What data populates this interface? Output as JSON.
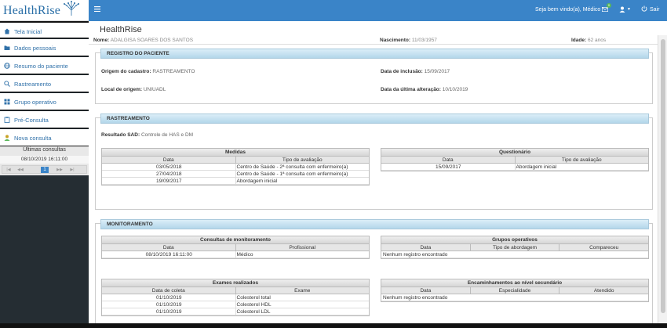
{
  "brand": {
    "name": "HealthRise"
  },
  "topbar": {
    "welcome": "Seja bem vindo(a), Médico",
    "mail_badge": "0",
    "user_caret": "▼",
    "logout": "Sair"
  },
  "sidebar": {
    "items": [
      {
        "label": "Tela Inicial",
        "icon": "home-icon"
      },
      {
        "label": "Dados pessoais",
        "icon": "folder-icon"
      },
      {
        "label": "Resumo do paciente",
        "icon": "globe-icon"
      },
      {
        "label": "Rastreamento",
        "icon": "search-icon"
      },
      {
        "label": "Grupo operativo",
        "icon": "grid-icon"
      },
      {
        "label": "Pré-Consulta",
        "icon": "clipboard-icon"
      },
      {
        "label": "Nova consulta",
        "icon": "user-icon"
      }
    ],
    "last_consults": {
      "title": "Últimas consultas",
      "rows": [
        "08/10/2019 16:11:00"
      ],
      "pager": {
        "first": "|◀",
        "prev": "◀◀",
        "current": "1",
        "next": "▶▶",
        "last": "▶|"
      }
    }
  },
  "main": {
    "title": "HealthRise",
    "patient": {
      "name_label": "Nome:",
      "name_value": "ADALGISA SOARES DOS SANTOS",
      "birth_label": "Nascimento:",
      "birth_value": "11/03/1957",
      "age_label": "Idade:",
      "age_value": "62 anos"
    },
    "registro": {
      "heading": "REGISTRO DO PACIENTE",
      "origem_label": "Origem do cadastro:",
      "origem_value": "RASTREAMENTO",
      "inclusao_label": "Data de inclusão:",
      "inclusao_value": "15/09/2017",
      "local_label": "Local de origem:",
      "local_value": "UNIUADL",
      "alteracao_label": "Data da última alteração:",
      "alteracao_value": "10/10/2019"
    },
    "rastreamento": {
      "heading": "RASTREAMENTO",
      "sad_label": "Resultado SAD:",
      "sad_value": "Controle de HAS e DM",
      "medidas": {
        "title": "Medidas",
        "columns": [
          "Data",
          "Tipo de avaliação"
        ],
        "rows": [
          [
            "03/05/2018",
            "Centro de Saúde - 2ª consulta com enfermeiro(a)"
          ],
          [
            "27/04/2018",
            "Centro de Saúde - 1ª consulta com enfermeiro(a)"
          ],
          [
            "19/09/2017",
            "Abordagem inicial"
          ]
        ]
      },
      "questionario": {
        "title": "Questionário",
        "columns": [
          "Data",
          "Tipo de avaliação"
        ],
        "rows": [
          [
            "15/09/2017",
            "Abordagem inicial"
          ]
        ]
      }
    },
    "monitoramento": {
      "heading": "MONITORAMENTO",
      "consultas": {
        "title": "Consultas de monitoramento",
        "columns": [
          "Data",
          "Profissional"
        ],
        "rows": [
          [
            "08/10/2019 16:11:00",
            "Médico"
          ]
        ]
      },
      "grupos": {
        "title": "Grupos operativos",
        "columns": [
          "Data",
          "Tipo de abordagem",
          "Compareceu"
        ],
        "empty": "Nenhum registro encontrado"
      },
      "exames": {
        "title": "Exames realizados",
        "columns": [
          "Data de coleta",
          "Exame"
        ],
        "rows": [
          [
            "01/10/2019",
            "Colesterol total"
          ],
          [
            "01/10/2019",
            "Colesterol HDL"
          ],
          [
            "01/10/2019",
            "Colesterol LDL"
          ]
        ]
      },
      "encaminhamentos": {
        "title": "Encaminhamentos ao nível secundário",
        "columns": [
          "Data",
          "Especialidade",
          "Atendido"
        ],
        "empty": "Nenhum registro encontrado"
      }
    }
  },
  "colors": {
    "accent": "#3a84c8",
    "sidebar_dark": "#252d33",
    "panel_header": "#b3d6ea"
  }
}
